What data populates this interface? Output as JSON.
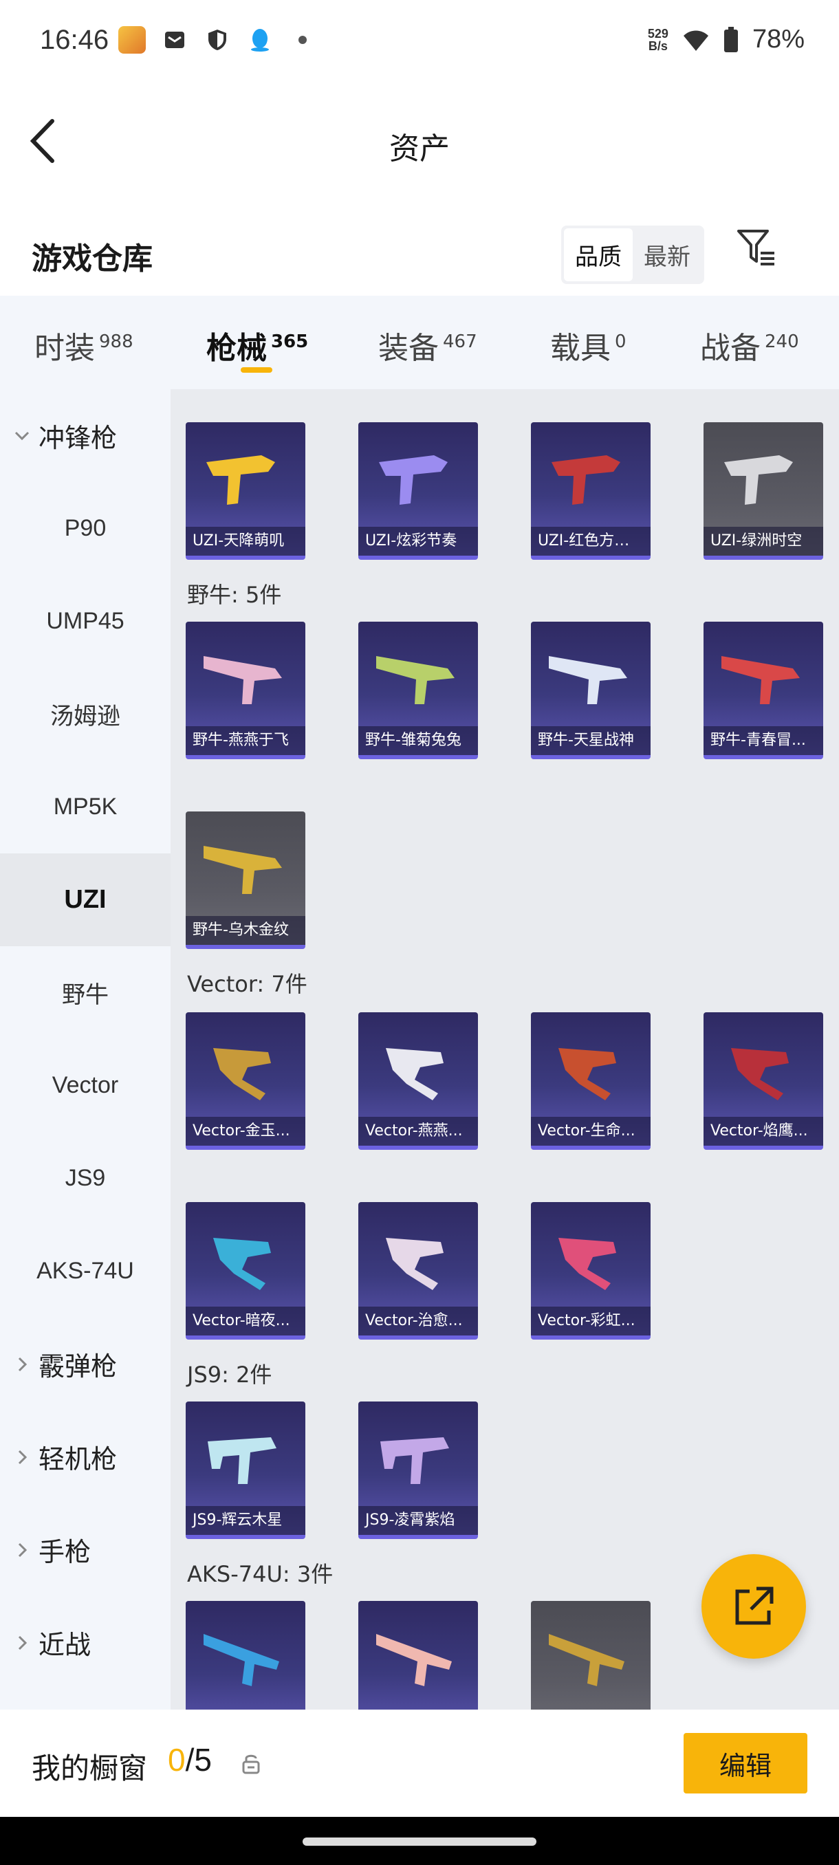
{
  "status_bar": {
    "time": "16:46",
    "net_speed": "529",
    "net_unit": "B/s",
    "battery": "78%"
  },
  "header": {
    "title": "资产"
  },
  "section": {
    "title": "游戏仓库",
    "sort_quality": "品质",
    "sort_latest": "最新"
  },
  "tabs": [
    {
      "label": "时装",
      "count": "988"
    },
    {
      "label": "枪械",
      "count": "365"
    },
    {
      "label": "装备",
      "count": "467"
    },
    {
      "label": "载具",
      "count": "0"
    },
    {
      "label": "战备",
      "count": "240"
    }
  ],
  "sidebar": {
    "group_smg": "冲锋枪",
    "items": [
      "P90",
      "UMP45",
      "汤姆逊",
      "MP5K",
      "UZI",
      "野牛",
      "Vector",
      "JS9",
      "AKS-74U"
    ],
    "group_shotgun": "霰弹枪",
    "group_lmg": "轻机枪",
    "group_pistol": "手枪",
    "group_melee": "近战"
  },
  "content": {
    "uzi_cards": [
      "UZI-天降萌叽",
      "UZI-炫彩节奏",
      "UZI-红色方程...",
      "UZI-绿洲时空"
    ],
    "bizon_label": "野牛: 5件",
    "bizon_cards": [
      "野牛-燕燕于飞",
      "野牛-雏菊兔兔",
      "野牛-天星战神",
      "野牛-青春冒...",
      "野牛-乌木金纹"
    ],
    "vector_label": "Vector: 7件",
    "vector_cards": [
      "Vector-金玉...",
      "Vector-燕燕...",
      "Vector-生命...",
      "Vector-焰鹰...",
      "Vector-暗夜...",
      "Vector-治愈...",
      "Vector-彩虹..."
    ],
    "js9_label": "JS9: 2件",
    "js9_cards": [
      "JS9-辉云木星",
      "JS9-凌霄紫焰"
    ],
    "aks_label": "AKS-74U: 3件"
  },
  "bottom": {
    "title": "我的橱窗",
    "count_current": "0",
    "count_sep_total": "/5",
    "edit_label": "编辑"
  },
  "colors": {
    "accent": "#f8b40a",
    "card_purple": "#3b3a7e",
    "card_border": "#6c62e0"
  }
}
